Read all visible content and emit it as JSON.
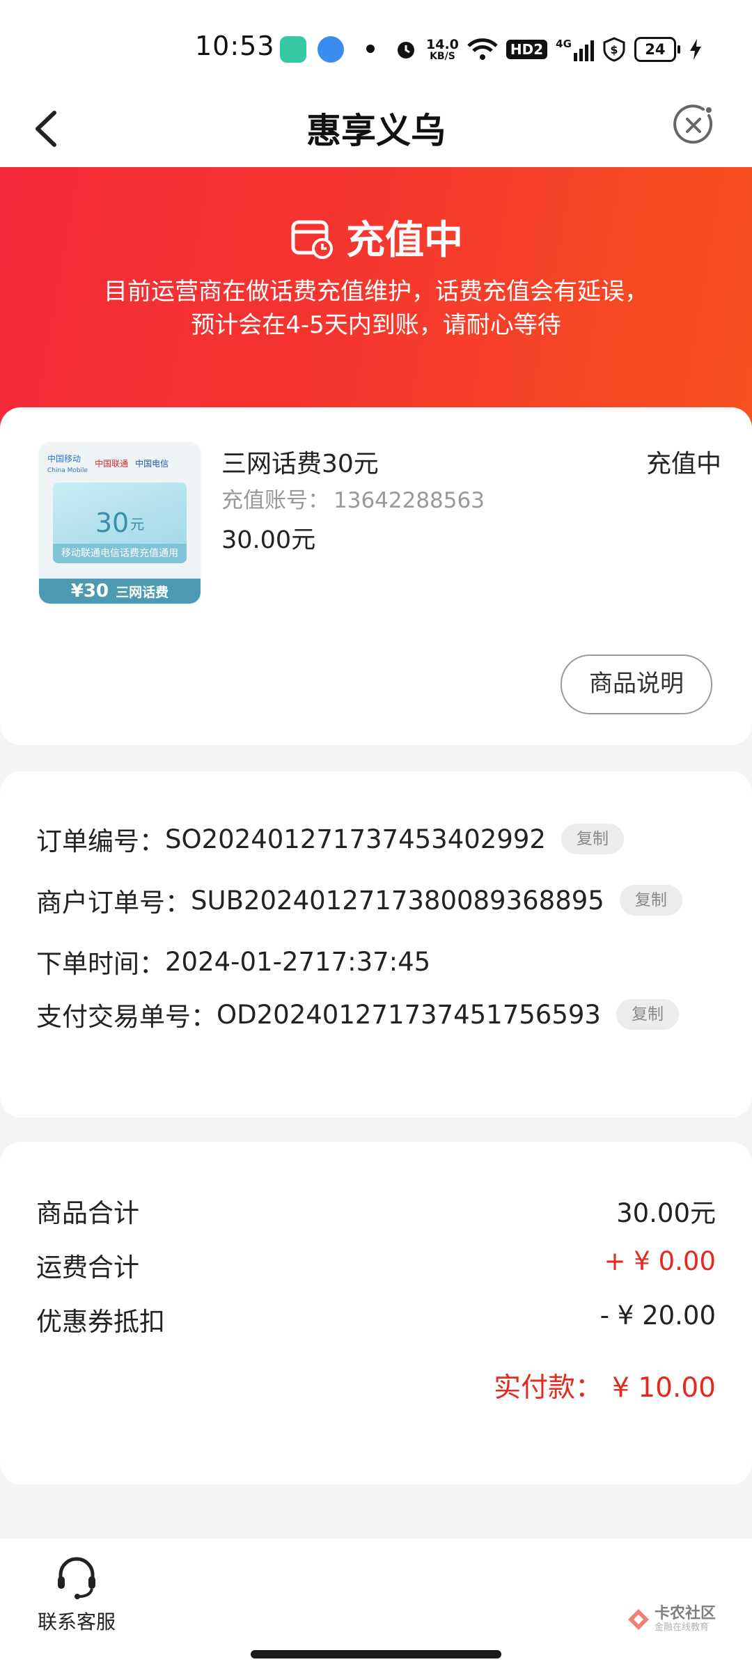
{
  "status_bar": {
    "time": "10:53",
    "net_speed_value": "14.0",
    "net_speed_unit": "KB/S",
    "hd_label": "HD2",
    "network_label": "4G",
    "battery": "24"
  },
  "nav": {
    "title": "惠享义乌"
  },
  "banner": {
    "title": "充值中",
    "message_line1": "目前运营商在做话费充值维护，话费充值会有延误，",
    "message_line2": "预计会在4-5天内到账，请耐心等待",
    "bg_color_start": "#f32a3a",
    "bg_color_end": "#f8521f"
  },
  "product": {
    "image": {
      "logo_mobile": "中国移动",
      "logo_mobile_en": "China Mobile",
      "logo_unicom": "中国联通",
      "logo_telecom": "中国电信",
      "amount": "30",
      "unit": "元",
      "caption": "移动联通电信话费充值通用",
      "band_price": "¥30",
      "band_label": "三网话费"
    },
    "name": "三网话费30元",
    "status": "充值中",
    "account_label": "充值账号：",
    "account_value": "13642288563",
    "price": "30.00元",
    "desc_button": "商品说明"
  },
  "order": {
    "rows": [
      {
        "label": "订单编号：",
        "value": "SO20240127173745340 2992",
        "copy": "复制"
      },
      {
        "label": "商户订单号：",
        "value": "SUB20240127173800893688 95",
        "copy": "复制"
      },
      {
        "label": "下单时间：",
        "value": "2024-01-27 17:37:45"
      },
      {
        "label": "支付交易单号：",
        "value": "OD20240127173745175659 3",
        "copy": "复制"
      }
    ]
  },
  "summary": {
    "goods_total_label": "商品合计",
    "goods_total_value": "30.00元",
    "shipping_label": "运费合计",
    "shipping_value": "+ ¥ 0.00",
    "coupon_label": "优惠券抵扣",
    "coupon_value": "- ¥ 20.00",
    "paid_label": "实付款：",
    "paid_value": "¥ 10.00",
    "accent_color": "#e5291c"
  },
  "bottom": {
    "service_label": "联系客服",
    "watermark_title": "卡农社区",
    "watermark_sub": "金融在线教育"
  }
}
